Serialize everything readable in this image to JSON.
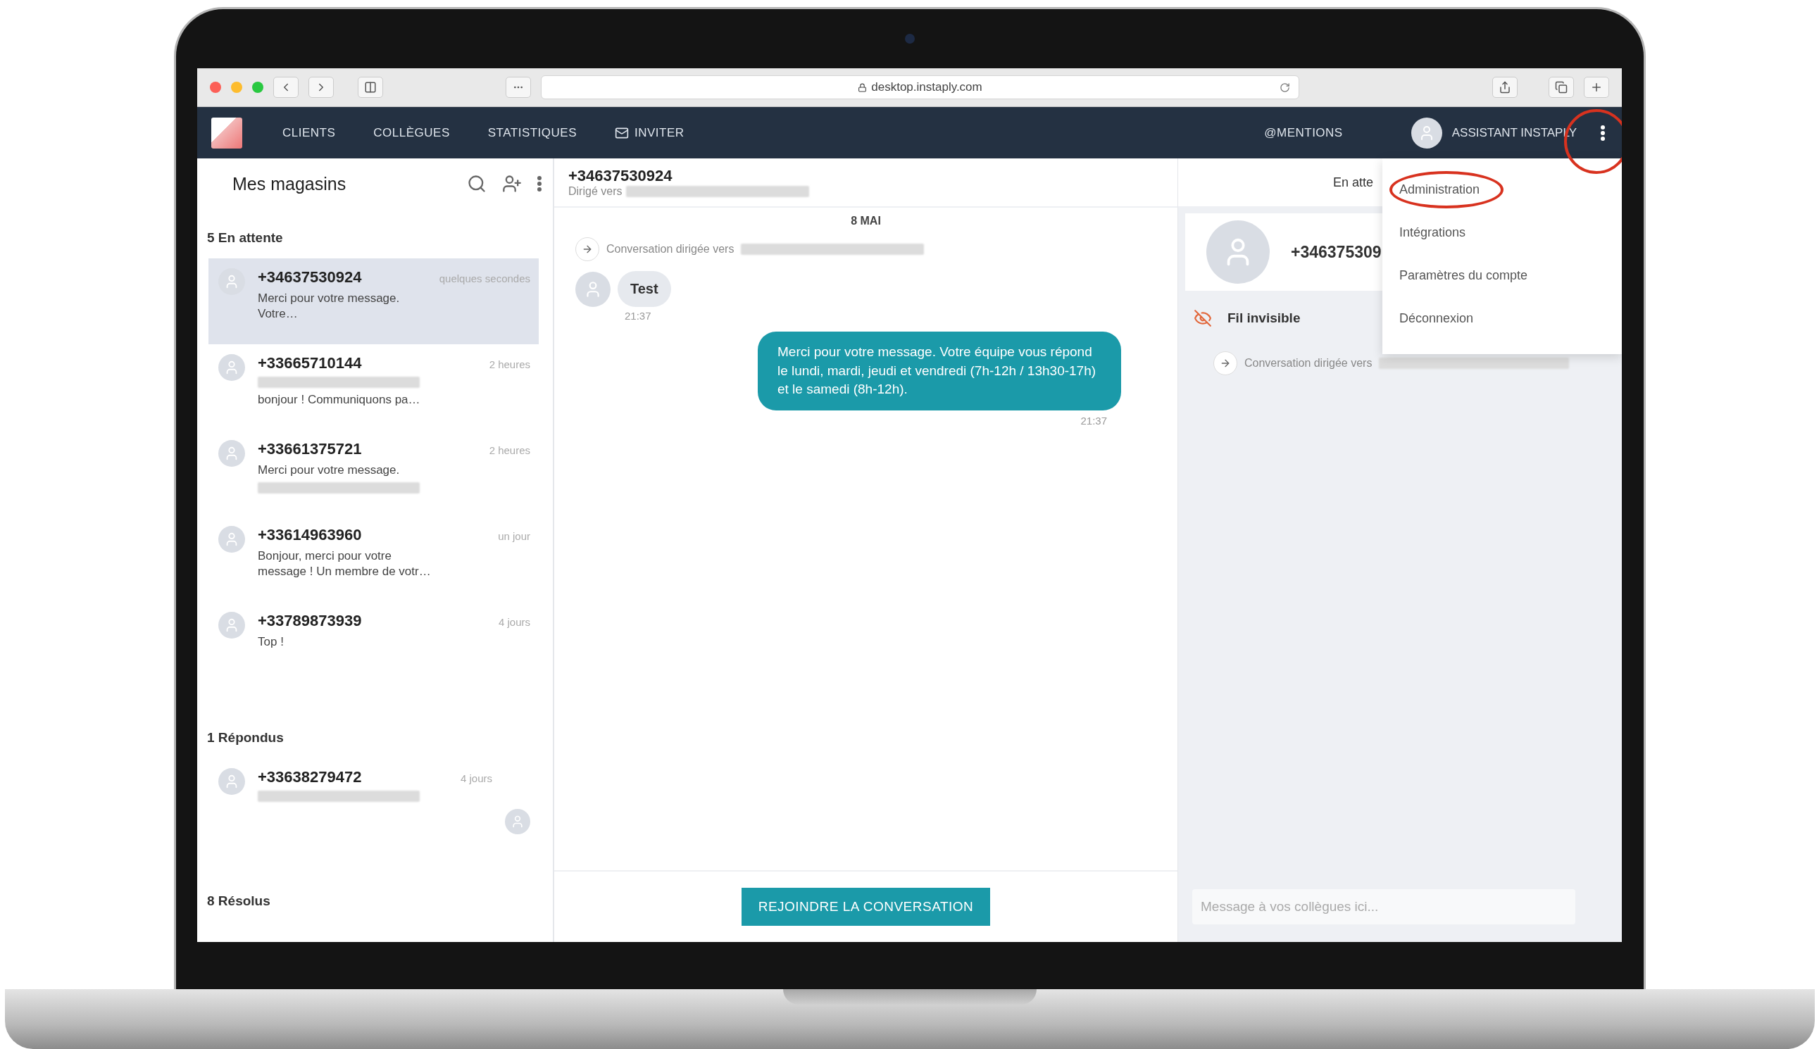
{
  "browser": {
    "url": "desktop.instaply.com"
  },
  "nav": {
    "items": [
      {
        "label": "CLIENTS",
        "kind": "text"
      },
      {
        "label": "COLLÈGUES",
        "kind": "text"
      },
      {
        "label": "STATISTIQUES",
        "kind": "text"
      },
      {
        "label": "INVITER",
        "kind": "mail"
      }
    ],
    "mentions": "@MENTIONS",
    "user": "ASSISTANT INSTAPLY"
  },
  "menu": {
    "items": [
      {
        "label": "Administration",
        "highlighted": true
      },
      {
        "label": "Intégrations",
        "highlighted": false
      },
      {
        "label": "Paramètres du compte",
        "highlighted": false
      },
      {
        "label": "Déconnexion",
        "highlighted": false
      }
    ]
  },
  "sidebar": {
    "title": "Mes magasins",
    "sections": [
      {
        "title": "5 En attente",
        "conversations": [
          {
            "phone": "+34637530924",
            "time": "quelques secondes",
            "selected": true,
            "assigned": false,
            "lines": [
              {
                "kind": "text",
                "text": "Merci pour votre message. Votre…"
              }
            ]
          },
          {
            "phone": "+33665710144",
            "time": "2 heures",
            "selected": false,
            "assigned": false,
            "lines": [
              {
                "kind": "redacted"
              },
              {
                "kind": "text",
                "text": "bonjour ! Communiquons pa…"
              }
            ]
          },
          {
            "phone": "+33661375721",
            "time": "2 heures",
            "selected": false,
            "assigned": false,
            "lines": [
              {
                "kind": "text",
                "text": "Merci pour votre message."
              },
              {
                "kind": "redacted"
              }
            ]
          },
          {
            "phone": "+33614963960",
            "time": "un jour",
            "selected": false,
            "assigned": false,
            "lines": [
              {
                "kind": "text",
                "text": "Bonjour, merci pour votre message ! Un membre de votr…"
              }
            ]
          },
          {
            "phone": "+33789873939",
            "time": "4 jours",
            "selected": false,
            "assigned": false,
            "lines": [
              {
                "kind": "text",
                "text": "Top !"
              }
            ]
          }
        ]
      },
      {
        "title": "1 Répondus",
        "conversations": [
          {
            "phone": "+33638279472",
            "time": "4 jours",
            "selected": false,
            "assigned": true,
            "lines": [
              {
                "kind": "redacted"
              }
            ]
          }
        ]
      },
      {
        "title": "8 Résolus"
      }
    ]
  },
  "conversation": {
    "phone": "+34637530924",
    "routed_label": "Dirigé vers",
    "status": "En atte",
    "messages": [
      {
        "kind": "date",
        "text": "8 MAI"
      },
      {
        "kind": "event",
        "text": "Conversation dirigée vers"
      },
      {
        "kind": "incoming",
        "text": "Test",
        "time": "21:37"
      },
      {
        "kind": "outgoing",
        "text": "Merci pour votre message. Votre équipe vous répond le lundi, mardi, jeudi et vendredi (7h-12h / 13h30-17h) et le samedi (8h-12h).",
        "time": "21:37"
      }
    ],
    "join_button": "REJOINDRE LA CONVERSATION"
  },
  "details": {
    "phone": "+346375309",
    "thread": "Fil invisible",
    "event": "Conversation dirigée vers",
    "placeholder": "Message à vos collègues ici..."
  }
}
